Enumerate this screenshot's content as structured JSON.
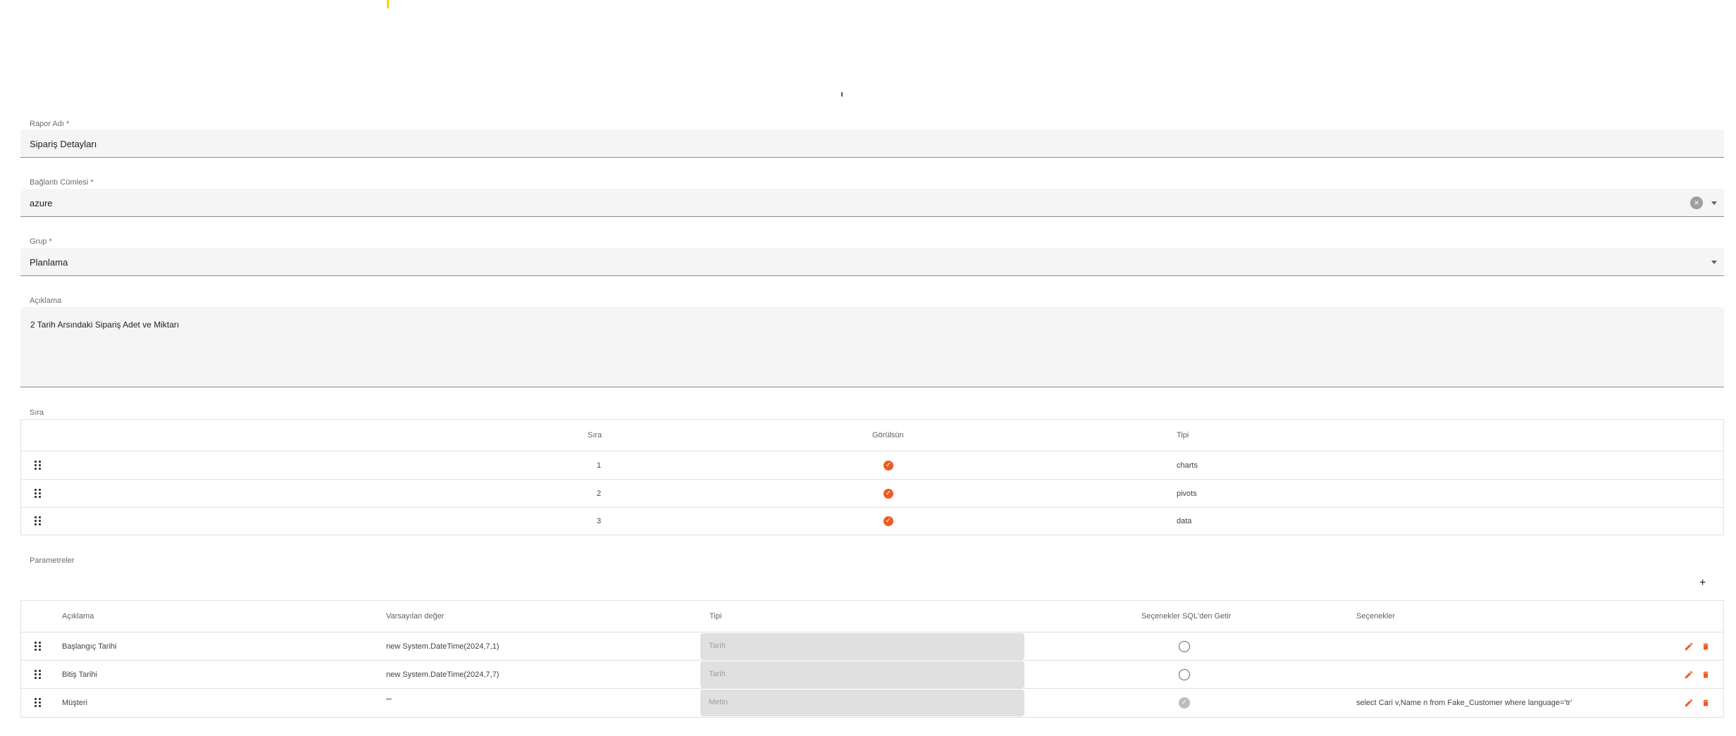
{
  "form": {
    "report_name": {
      "label": "Rapor Adı *",
      "value": "Sipariş Detayları"
    },
    "connection": {
      "label": "Bağlantı Cümlesi *",
      "value": "azure"
    },
    "group": {
      "label": "Grup *",
      "value": "Planlama"
    },
    "description": {
      "label": "Açıklama",
      "value": "2 Tarih Arsındaki Sipariş Adet ve Miktarı"
    }
  },
  "order_section": {
    "label": "Sıra",
    "headers": {
      "order": "Sıra",
      "visible": "Görülsün",
      "type": "Tipi"
    },
    "rows": [
      {
        "order": "1",
        "visible": true,
        "type": "charts"
      },
      {
        "order": "2",
        "visible": true,
        "type": "pivots"
      },
      {
        "order": "3",
        "visible": true,
        "type": "data"
      }
    ]
  },
  "params_section": {
    "label": "Parametreler",
    "add_label": "+",
    "headers": {
      "description": "Açıklama",
      "default": "Varsayılan değer",
      "type": "Tipi",
      "from_sql": "Seçenekler SQL'den Getir",
      "options": "Seçenekler"
    },
    "rows": [
      {
        "description": "Başlangıç Tarihi",
        "default": "new System.DateTime(2024,7,1)",
        "type": "Tarih",
        "from_sql": false,
        "options": ""
      },
      {
        "description": "Bitiş Tarihi",
        "default": "new System.DateTime(2024,7,7)",
        "type": "Tarih",
        "from_sql": false,
        "options": ""
      },
      {
        "description": "Müşteri",
        "default": "\"\"",
        "type": "Metin",
        "from_sql": true,
        "options": "select Cari v,Name n from Fake_Customer where language='tr'"
      }
    ]
  },
  "colors": {
    "accent": "#f05a22",
    "field_bg": "#f5f5f5",
    "disabled_bg": "#e0e0e0"
  }
}
